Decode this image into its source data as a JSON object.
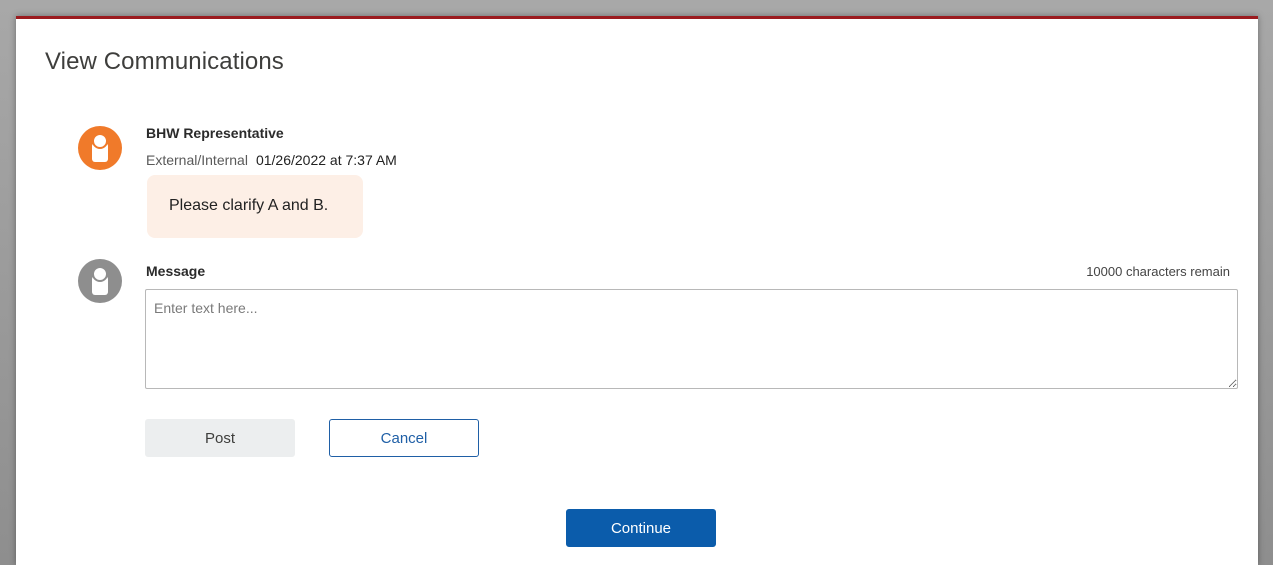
{
  "page": {
    "title": "View Communications"
  },
  "thread": {
    "messages": [
      {
        "sender": "BHW Representative",
        "role": "External/Internal",
        "timestamp": "01/26/2022 at 7:37 AM",
        "text": "Please clarify A and B.",
        "avatar_icon": "user-icon",
        "avatar_color": "#f07a2a",
        "bubble_color": "#fdefe6"
      }
    ]
  },
  "composer": {
    "label": "Message",
    "chars_remaining": "10000 characters remain",
    "placeholder": "Enter text here...",
    "value": "",
    "avatar_icon": "user-icon",
    "avatar_color": "#8e8e8e",
    "post_label": "Post",
    "cancel_label": "Cancel"
  },
  "footer": {
    "continue_label": "Continue"
  },
  "colors": {
    "accent_top_border": "#9b1b1f",
    "primary_button": "#0b5cab",
    "cancel_outline": "#1f5fa6"
  }
}
